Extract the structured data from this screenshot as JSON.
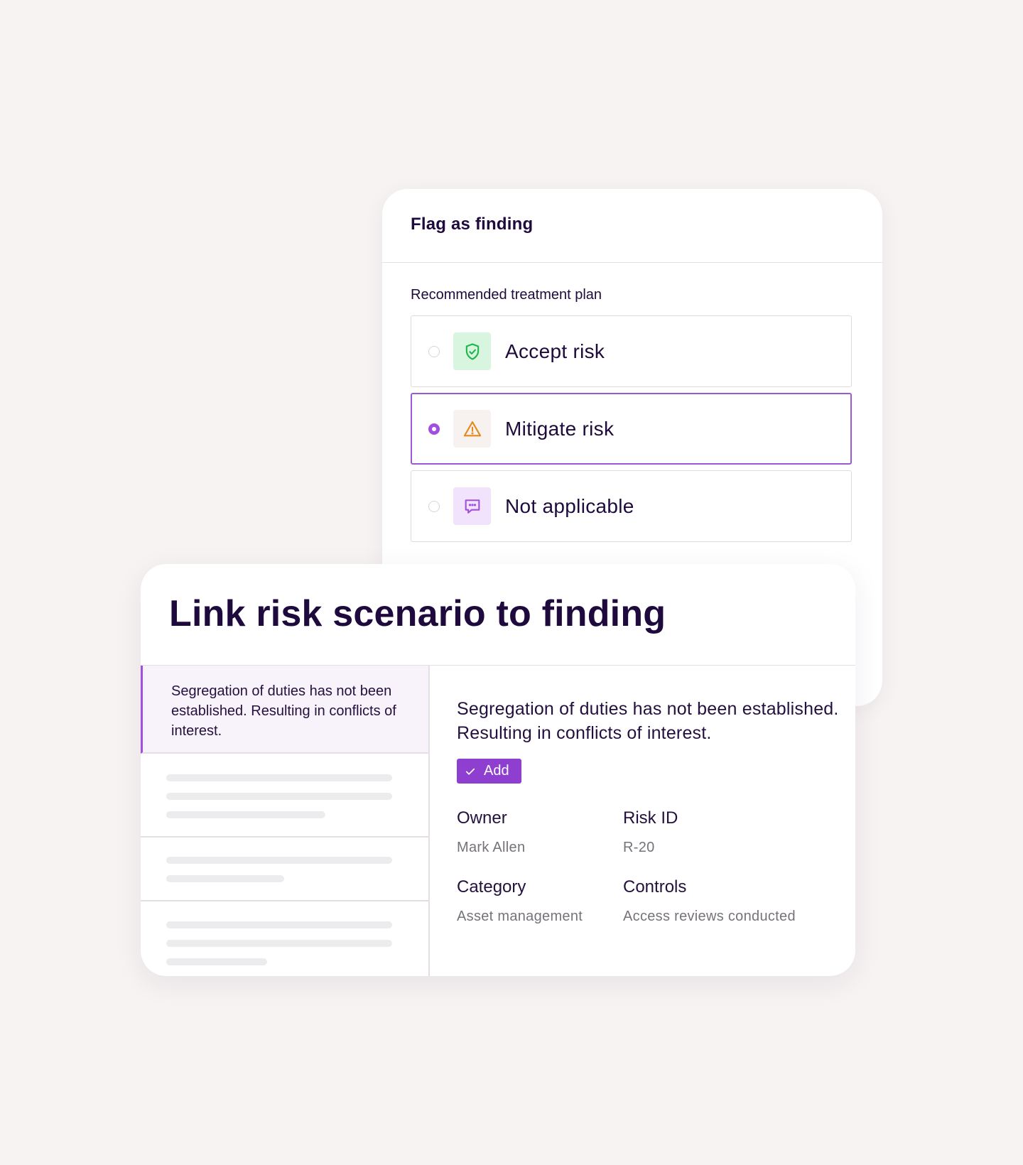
{
  "flag_card": {
    "title": "Flag as finding",
    "section_label": "Recommended treatment plan",
    "options": [
      {
        "label": "Accept risk",
        "icon": "shield-check-icon",
        "icon_color": "#1fb549",
        "icon_bg": "#d7f5df",
        "selected": false
      },
      {
        "label": "Mitigate risk",
        "icon": "warning-triangle-icon",
        "icon_color": "#e48a1b",
        "icon_bg": "#f7f2f0",
        "selected": true
      },
      {
        "label": "Not applicable",
        "icon": "chat-bubble-icon",
        "icon_color": "#a24ee0",
        "icon_bg": "#f1e3fb",
        "selected": false
      }
    ]
  },
  "link_card": {
    "title": "Link risk scenario to finding",
    "list": {
      "active_item": "Segregation of duties has not been established. Resulting in conflicts of interest."
    },
    "detail": {
      "title": "Segregation of duties has not been established. Resulting in conflicts of interest.",
      "add_label": "Add",
      "fields": [
        {
          "label": "Owner",
          "value": "Mark Allen"
        },
        {
          "label": "Risk ID",
          "value": "R-20"
        },
        {
          "label": "Category",
          "value": "Asset management"
        },
        {
          "label": "Controls",
          "value": "Access reviews conducted"
        }
      ]
    }
  },
  "colors": {
    "background": "#f6f3f2",
    "text": "#1f0a3d",
    "accent": "#8f3fd0",
    "selected_border": "#9b59d6"
  }
}
